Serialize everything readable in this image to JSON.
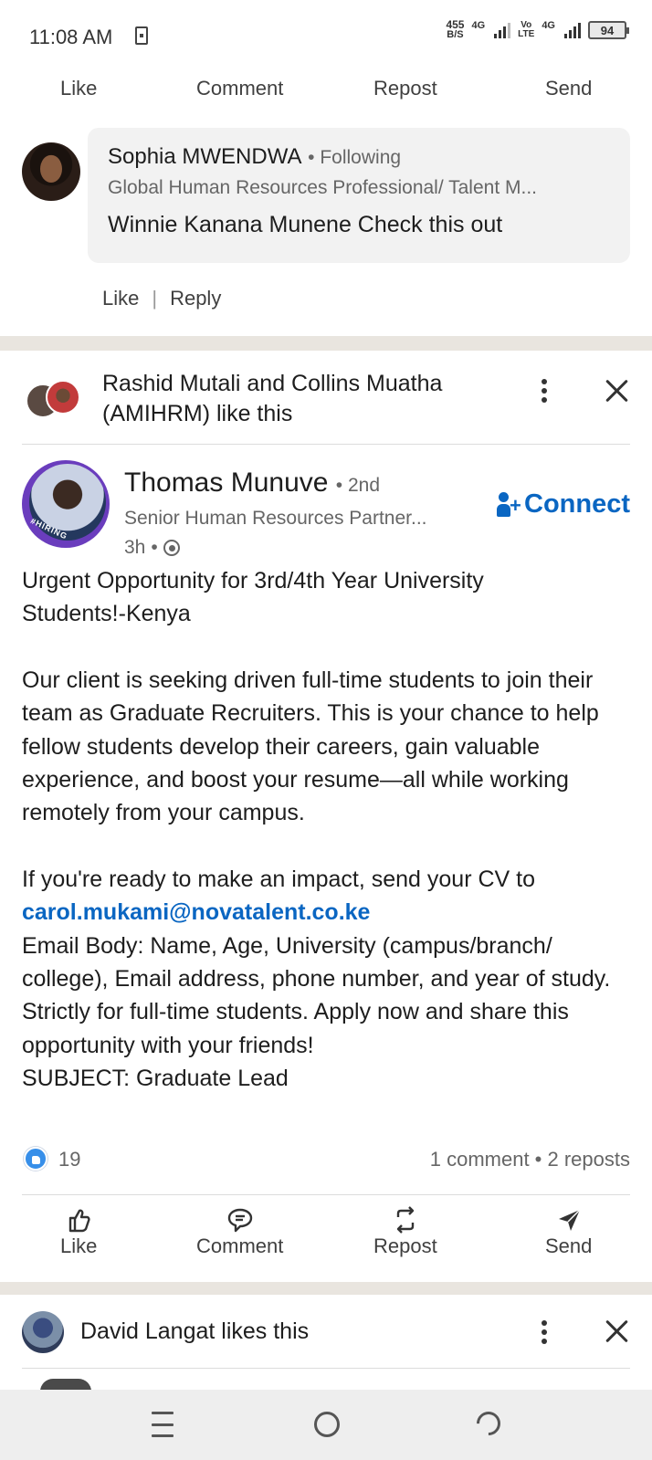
{
  "status_bar": {
    "time": "11:08 AM",
    "net_speed_value": "455",
    "net_speed_unit": "B/S",
    "sim1_label": "4G",
    "volte_top": "Vo",
    "volte_bottom": "LTE",
    "sim2_label": "4G",
    "battery": "94"
  },
  "top_actions": {
    "like": "Like",
    "comment": "Comment",
    "repost": "Repost",
    "send": "Send"
  },
  "comment": {
    "author": "Sophia MWENDWA",
    "follow_status": "Following",
    "headline": "Global Human Resources Professional/ Talent M...",
    "text": "Winnie Kanana Munene Check this out",
    "like_label": "Like",
    "reply_label": "Reply"
  },
  "social_context": {
    "text": "Rashid Mutali and Collins Muatha (AMIHRM) like this"
  },
  "post": {
    "author": "Thomas Munuve",
    "degree": "2nd",
    "headline": "Senior Human Resources Partner...",
    "time": "3h",
    "avatar_badge": "#HIRING",
    "connect_label": "Connect",
    "body": {
      "line1": "Urgent Opportunity for 3rd/4th Year University",
      "line2": "Students!-Kenya",
      "para2": "Our client is seeking driven full-time students to join their team as Graduate Recruiters. This is your chance to help fellow students develop their careers, gain valuable experience, and boost your resume—all while working remotely from your campus.",
      "para3_intro": "If you're ready to make an impact, send your CV to",
      "email": "carol.mukami@novatalent.co.ke",
      "para3_rest": "Email Body: Name, Age, University (campus/branch/ college), Email address, phone number, and year of study. Strictly for full-time students. Apply now and share this opportunity with your friends!",
      "subject": "SUBJECT: Graduate Lead"
    },
    "reactions_count": "19",
    "engagement": "1 comment • 2 reposts"
  },
  "post_actions": {
    "like": "Like",
    "comment": "Comment",
    "repost": "Repost",
    "send": "Send"
  },
  "next_activity": {
    "text": "David Langat likes this"
  },
  "colors": {
    "link_blue": "#0a66c2",
    "reaction_blue": "#378fe9",
    "divider": "#e9e5df"
  }
}
